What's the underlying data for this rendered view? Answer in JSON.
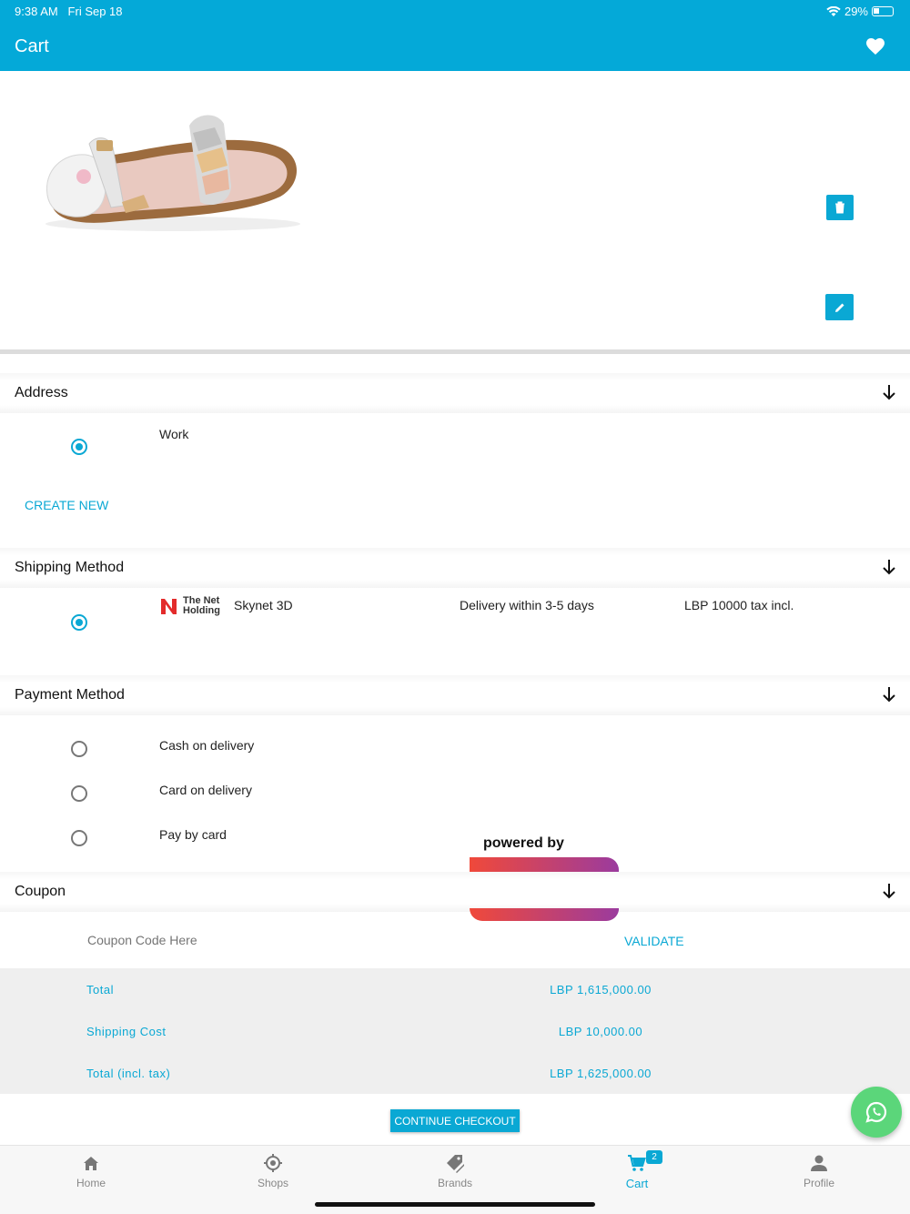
{
  "status_bar": {
    "time": "9:38 AM",
    "date": "Fri Sep 18",
    "battery": "29%"
  },
  "app_bar": {
    "title": "Cart",
    "favorite_icon": "heart-icon"
  },
  "colors": {
    "accent": "#0aa8d4",
    "header": "#04a9d8",
    "whatsapp": "#5bd67a"
  },
  "address": {
    "header": "Address",
    "option": "Work",
    "create_new": "CREATE NEW"
  },
  "shipping": {
    "header": "Shipping Method",
    "carrier_logo_line1": "The Net",
    "carrier_logo_line2": "Holding",
    "name": "Skynet 3D",
    "delivery": "Delivery within 3-5 days",
    "price": "LBP 10000 tax incl."
  },
  "payment": {
    "header": "Payment Method",
    "options": [
      "Cash on delivery",
      "Card on delivery",
      "Pay by card"
    ]
  },
  "coupon": {
    "header": "Coupon",
    "placeholder": "Coupon Code Here",
    "validate": "VALIDATE"
  },
  "totals": {
    "total_label": "Total",
    "total_value": "LBP 1,615,000.00",
    "shipping_label": "Shipping Cost",
    "shipping_value": "LBP 10,000.00",
    "grand_label": "Total (incl. tax)",
    "grand_value": "LBP 1,625,000.00"
  },
  "checkout_label": "CONTINUE CHECKOUT",
  "powered_by": "powered by",
  "tabs": [
    {
      "label": "Home",
      "icon": "home-icon"
    },
    {
      "label": "Shops",
      "icon": "location-icon"
    },
    {
      "label": "Brands",
      "icon": "tag-icon"
    },
    {
      "label": "Cart",
      "icon": "cart-icon",
      "badge": "2"
    },
    {
      "label": "Profile",
      "icon": "person-icon"
    }
  ]
}
